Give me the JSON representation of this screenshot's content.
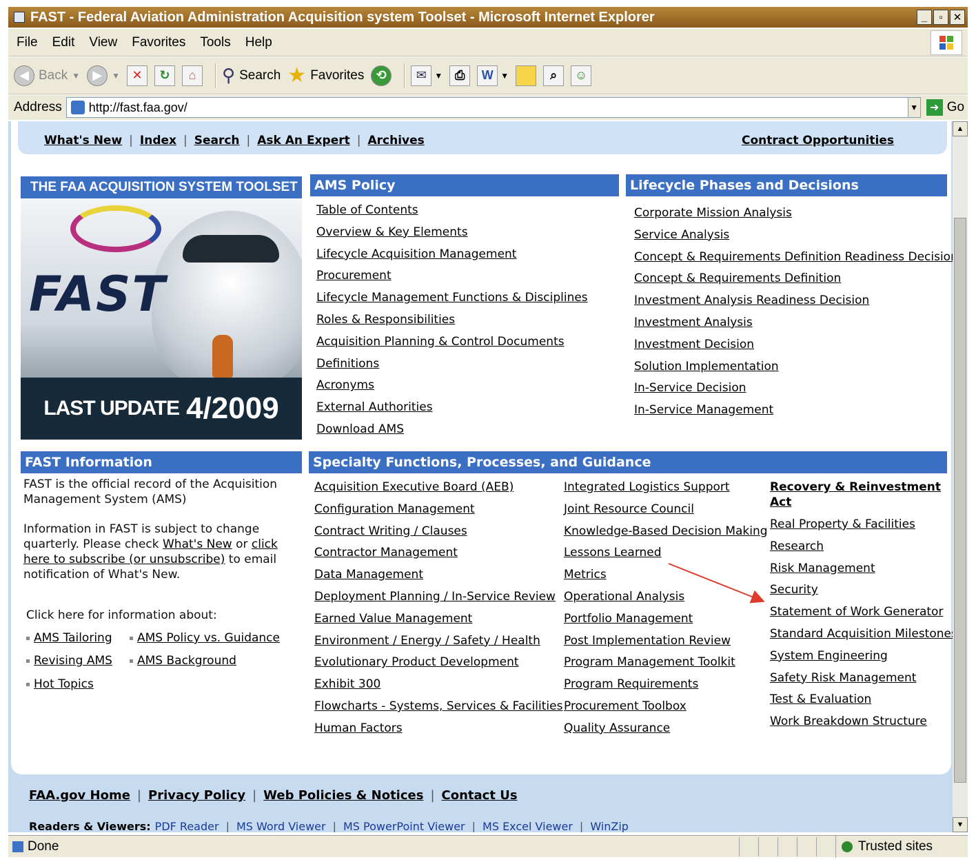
{
  "window": {
    "title": "FAST - Federal Aviation Administration Acquisition system Toolset - Microsoft Internet Explorer",
    "controls": [
      "_",
      "▫",
      "✕"
    ]
  },
  "menu": [
    "File",
    "Edit",
    "View",
    "Favorites",
    "Tools",
    "Help"
  ],
  "toolbar": {
    "back_label": "Back",
    "search_label": "Search",
    "favorites_label": "Favorites"
  },
  "address": {
    "label": "Address",
    "url": "http://fast.faa.gov/",
    "go_label": "Go"
  },
  "topnav": {
    "links": [
      "What's New",
      "Index",
      "Search",
      "Ask An Expert",
      "Archives"
    ],
    "right_link": "Contract Opportunities"
  },
  "banner": {
    "title": "THE FAA ACQUISITION SYSTEM TOOLSET",
    "logo": "FAST",
    "last_update_label": "LAST UPDATE",
    "last_update_date": "4/2009"
  },
  "ams_policy": {
    "heading": "AMS Policy",
    "links": [
      "Table of Contents",
      "Overview & Key Elements",
      "Lifecycle Acquisition Management",
      "Procurement",
      "Lifecycle Management Functions & Disciplines",
      "Roles & Responsibilities",
      "Acquisition Planning & Control Documents",
      "Definitions",
      "Acronyms",
      "External Authorities",
      "Download AMS"
    ]
  },
  "lifecycle": {
    "heading": "Lifecycle Phases and Decisions",
    "links": [
      "Corporate Mission Analysis",
      "Service Analysis",
      "Concept & Requirements Definition Readiness Decision",
      "Concept & Requirements Definition",
      "Investment Analysis Readiness Decision",
      "Investment Analysis",
      "Investment Decision",
      "Solution Implementation",
      "In-Service Decision",
      "In-Service Management"
    ]
  },
  "fast_info": {
    "heading": "FAST Information",
    "para1": "FAST is the official record of the Acquisition Management System (AMS)",
    "para2_a": "Information in FAST is subject to change quarterly.  Please check ",
    "para2_link1": "What's New",
    "para2_b": " or ",
    "para2_link2": "click here to subscribe (or unsubscribe)",
    "para2_c": " to email notification of What's New.",
    "click_here": "Click here for information about:",
    "bullets": [
      "AMS Tailoring",
      "AMS Policy vs. Guidance",
      "Revising AMS",
      "AMS Background",
      "Hot Topics"
    ]
  },
  "specialty": {
    "heading": "Specialty Functions, Processes, and Guidance",
    "col1": [
      "Acquisition Executive Board (AEB)",
      "Configuration Management",
      "Contract Writing / Clauses",
      "Contractor Management",
      "Data Management",
      "Deployment Planning / In-Service Review",
      "Earned Value Management",
      "Environment / Energy / Safety / Health",
      "Evolutionary Product Development",
      "Exhibit 300",
      "Flowcharts - Systems, Services & Facilities",
      "Human Factors"
    ],
    "col2": [
      "Integrated Logistics Support",
      "Joint Resource Council",
      "Knowledge-Based Decision Making",
      "Lessons Learned",
      "Metrics",
      "Operational Analysis",
      "Portfolio Management",
      "Post Implementation Review",
      "Program Management Toolkit",
      "Program Requirements",
      "Procurement Toolbox",
      "Quality Assurance"
    ],
    "col3_bold_line1": "Recovery & Reinvestment",
    "col3_bold_line2": "Act",
    "col3": [
      "Real Property & Facilities",
      "Research",
      "Risk Management",
      "Security",
      "Statement of Work Generator",
      "Standard Acquisition Milestones",
      "System Engineering",
      "Safety Risk Management",
      "Test & Evaluation",
      "Work Breakdown Structure"
    ]
  },
  "footer": {
    "links": [
      "FAA.gov Home",
      "Privacy Policy",
      "Web Policies & Notices",
      "Contact Us"
    ],
    "readers_label": "Readers & Viewers:",
    "readers": [
      "PDF Reader",
      "MS Word Viewer",
      "MS PowerPoint Viewer",
      "MS Excel Viewer",
      "WinZip"
    ]
  },
  "status": {
    "text": "Done",
    "zone": "Trusted sites"
  },
  "colors": {
    "section_header": "#3a6fc4",
    "page_bg": "#c7dbf0",
    "annotation_arrow": "#e03a2a"
  }
}
